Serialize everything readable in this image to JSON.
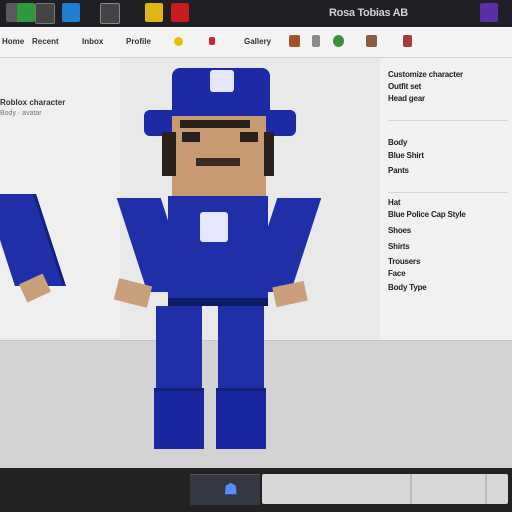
{
  "window": {
    "title": "Rosa Tobias AB"
  },
  "toolbar": {
    "items": [
      "Home",
      "Recent",
      "Inbox",
      "Profile",
      "Gallery"
    ]
  },
  "left_panel": {
    "title": "Roblox character",
    "subtitle": "Body · avatar"
  },
  "side_panel": {
    "header_line1": "Customize character",
    "header_line2": "Outfit set",
    "header_line3": "Head gear",
    "section": "Body",
    "section_item": "Blue Shirt",
    "field_label": "Pants",
    "group_title": "Hat",
    "group_line": "Blue Police Cap Style",
    "opt1": "Shoes",
    "opt2": "Shirts",
    "opt3": "Trousers",
    "opt4": "Face",
    "opt5": "Body Type"
  },
  "colors": {
    "character_blue": "#1f2fa8",
    "skin": "#c9a07a",
    "taskbar": "#222222"
  },
  "icons": [
    "app-icon-1",
    "app-icon-2",
    "app-icon-3",
    "app-icon-4",
    "app-icon-5",
    "app-icon-6",
    "app-icon-7"
  ]
}
